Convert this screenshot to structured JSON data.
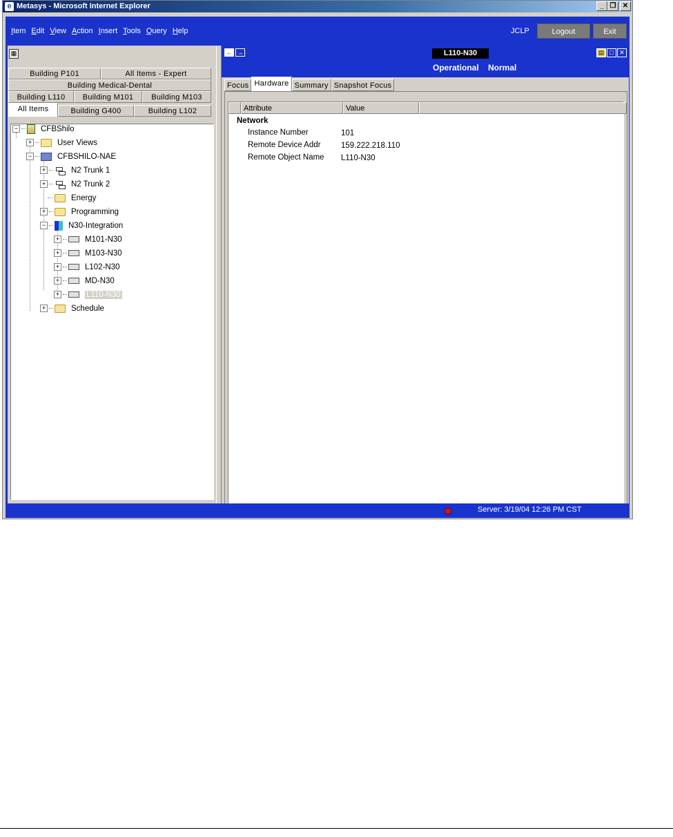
{
  "window": {
    "title": "Metasys - Microsoft Internet Explorer",
    "minimize": "_",
    "restore": "❐",
    "close": "✕"
  },
  "menu": {
    "items": [
      {
        "u": "I",
        "rest": "tem"
      },
      {
        "u": "E",
        "rest": "dit"
      },
      {
        "u": "V",
        "rest": "iew"
      },
      {
        "u": "A",
        "rest": "ction"
      },
      {
        "u": "I",
        "rest": "nsert"
      },
      {
        "u": "T",
        "rest": "ools"
      },
      {
        "u": "Q",
        "rest": "uery"
      },
      {
        "u": "H",
        "rest": "elp"
      }
    ],
    "user": "JCLP",
    "logout": "Logout",
    "exit": "Exit"
  },
  "left_tabs": {
    "row1": [
      "Building P101",
      "All Items - Expert"
    ],
    "row2": [
      "Building Medical-Dental"
    ],
    "row3": [
      "Building L110",
      "Building M101",
      "Building M103"
    ],
    "row4": [
      "All Items",
      "Building G400",
      "Building L102"
    ]
  },
  "tree": {
    "root": "CFBShilo",
    "user_views": "User Views",
    "nae": "CFBSHILO-NAE",
    "trunk1": "N2 Trunk 1",
    "trunk2": "N2 Trunk 2",
    "energy": "Energy",
    "programming": "Programming",
    "integration": "N30-Integration",
    "m101": "M101-N30",
    "m103": "M103-N30",
    "l102": "L102-N30",
    "md": "MD-N30",
    "l110": "L110-N30",
    "schedule": "Schedule"
  },
  "panel": {
    "object_title": "L110-N30",
    "status": "Operational",
    "state": "Normal",
    "tabs": [
      "Focus",
      "Hardware",
      "Summary",
      "Snapshot Focus"
    ],
    "active_tab": "Hardware"
  },
  "grid": {
    "col_attribute": "Attribute",
    "col_value": "Value",
    "section": "Network",
    "rows": [
      {
        "attr": "Instance Number",
        "value": "101"
      },
      {
        "attr": "Remote Device Addr",
        "value": "159.222.218.110"
      },
      {
        "attr": "Remote Object Name",
        "value": "L110-N30"
      }
    ]
  },
  "statusbar": {
    "server": "Server: 3/19/04 12:26 PM CST"
  }
}
